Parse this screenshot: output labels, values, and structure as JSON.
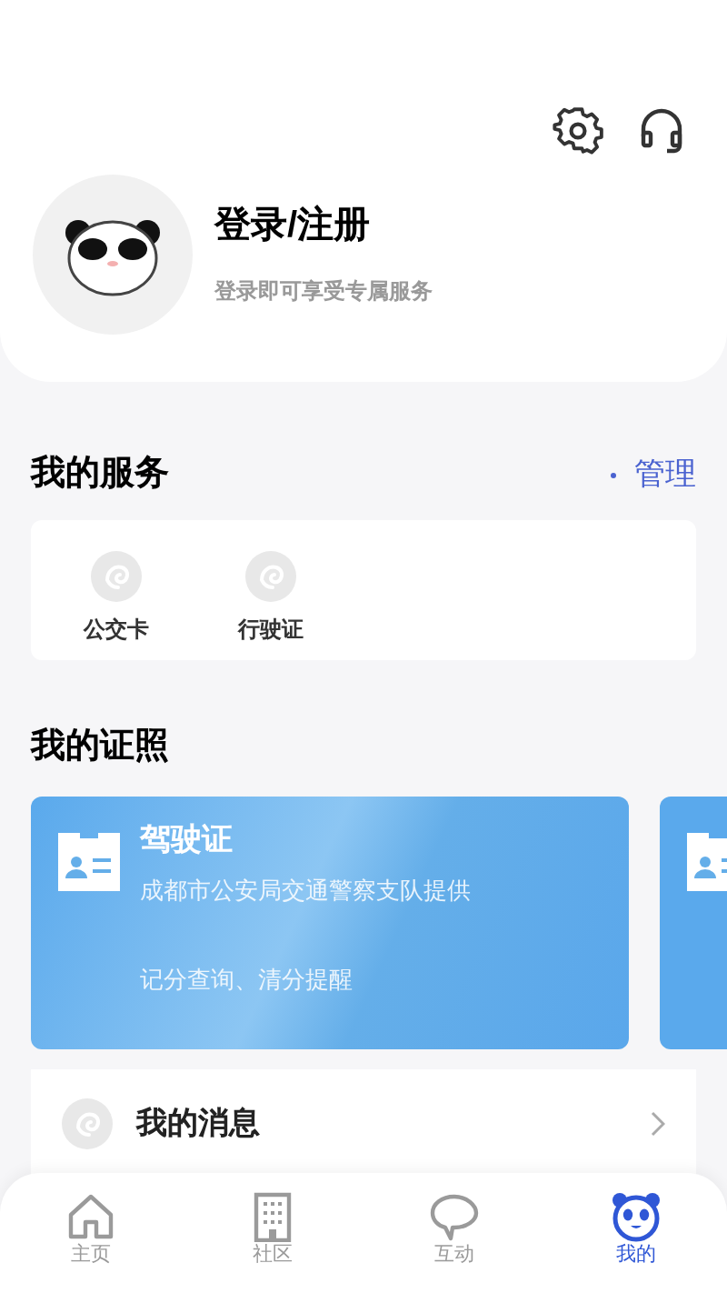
{
  "profile": {
    "title": "登录/注册",
    "subtitle": "登录即可享受专属服务"
  },
  "services": {
    "title": "我的服务",
    "manage": "管理",
    "items": [
      {
        "label": "公交卡"
      },
      {
        "label": "行驶证"
      }
    ]
  },
  "licenses": {
    "title": "我的证照",
    "cards": [
      {
        "name": "驾驶证",
        "issuer": "成都市公安局交通警察支队提供",
        "features": "记分查询、清分提醒"
      }
    ]
  },
  "messages": {
    "label": "我的消息"
  },
  "tab_bar": [
    {
      "label": "主页",
      "selected": false
    },
    {
      "label": "社区",
      "selected": false
    },
    {
      "label": "互动",
      "selected": false
    },
    {
      "label": "我的",
      "selected": true
    }
  ]
}
